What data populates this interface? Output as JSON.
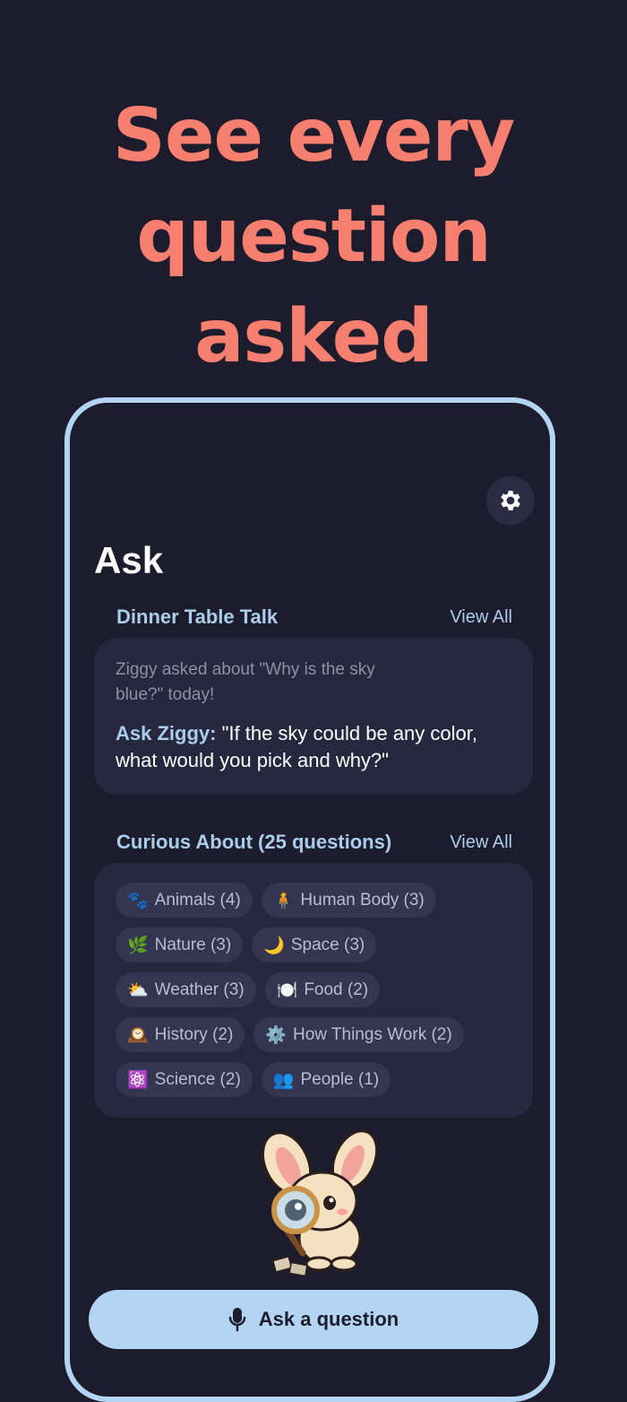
{
  "headline": [
    "See every",
    "question",
    "asked"
  ],
  "screen": {
    "title": "Ask",
    "settings_icon": "gear-icon"
  },
  "dinner": {
    "title": "Dinner Table Talk",
    "view_all": "View All",
    "summary": "Ziggy asked about \"Why is the sky blue?\" today!",
    "prompt_label": "Ask Ziggy:",
    "prompt_text": " \"If the sky could be any color, what would you pick and why?\""
  },
  "curious": {
    "title": "Curious About (25 questions)",
    "view_all": "View All",
    "chips": [
      {
        "icon": "🐾",
        "label": "Animals (4)"
      },
      {
        "icon": "🧍",
        "label": "Human Body (3)"
      },
      {
        "icon": "🌿",
        "label": "Nature (3)"
      },
      {
        "icon": "🌙",
        "label": "Space (3)"
      },
      {
        "icon": "⛅",
        "label": "Weather (3)"
      },
      {
        "icon": "🍽️",
        "label": "Food (2)"
      },
      {
        "icon": "🕰️",
        "label": "History (2)"
      },
      {
        "icon": "⚙️",
        "label": "How Things Work (2)"
      },
      {
        "icon": "⚛️",
        "label": "Science (2)"
      },
      {
        "icon": "👥",
        "label": "People (1)"
      }
    ]
  },
  "ask_button": {
    "label": "Ask a question",
    "icon": "microphone-icon"
  },
  "colors": {
    "background": "#1d1c2d",
    "headline": "#f77f6f",
    "accent": "#b3d5f3",
    "card": "#27283f"
  }
}
